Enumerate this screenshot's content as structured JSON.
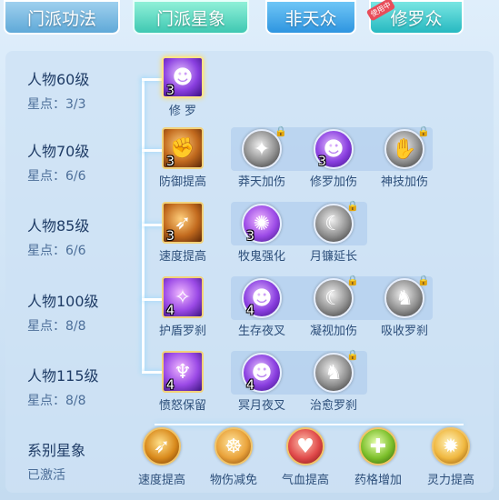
{
  "tabs": [
    {
      "label": "门派功法"
    },
    {
      "label": "门派星象"
    },
    {
      "label": "非天众"
    },
    {
      "label": "修罗众",
      "badge": "使用中"
    }
  ],
  "levels": [
    {
      "title": "人物60级",
      "stars": "星点：3/3"
    },
    {
      "title": "人物70级",
      "stars": "星点：6/6"
    },
    {
      "title": "人物85级",
      "stars": "星点：6/6"
    },
    {
      "title": "人物100级",
      "stars": "星点：8/8"
    },
    {
      "title": "人物115级",
      "stars": "星点：8/8"
    }
  ],
  "rows": [
    {
      "main": {
        "label": "修 罗",
        "num": "3",
        "icon": "demon-face-icon"
      },
      "subs": []
    },
    {
      "main": {
        "label": "防御提高",
        "num": "3",
        "icon": "flexed-arm-icon"
      },
      "subs": [
        {
          "label": "莽天加伤",
          "num": "",
          "icon": "dragon-icon",
          "locked": true
        },
        {
          "label": "修罗加伤",
          "num": "3",
          "icon": "demon-face-icon",
          "locked": false
        },
        {
          "label": "神技加伤",
          "num": "",
          "icon": "claw-icon",
          "locked": true
        }
      ]
    },
    {
      "main": {
        "label": "速度提高",
        "num": "3",
        "icon": "running-figure-icon"
      },
      "subs": [
        {
          "label": "牧鬼强化",
          "num": "3",
          "icon": "chest-icon",
          "locked": false
        },
        {
          "label": "月镰延长",
          "num": "",
          "icon": "sickle-icon",
          "locked": true
        }
      ]
    },
    {
      "main": {
        "label": "护盾罗刹",
        "num": "4",
        "icon": "shield-demon-icon"
      },
      "subs": [
        {
          "label": "生存夜叉",
          "num": "4",
          "icon": "demon-face-icon",
          "locked": false
        },
        {
          "label": "凝视加伤",
          "num": "",
          "icon": "crescent-icon",
          "locked": true
        },
        {
          "label": "吸收罗刹",
          "num": "",
          "icon": "beast-icon",
          "locked": true
        }
      ]
    },
    {
      "main": {
        "label": "愤怒保留",
        "num": "4",
        "icon": "winged-demon-icon"
      },
      "subs": [
        {
          "label": "冥月夜叉",
          "num": "4",
          "icon": "demon-face-icon",
          "locked": false
        },
        {
          "label": "治愈罗刹",
          "num": "",
          "icon": "beast-icon",
          "locked": true
        }
      ]
    }
  ],
  "system": {
    "title": "系别星象",
    "status": "已激活"
  },
  "bottom": [
    {
      "label": "速度提高",
      "icon": "running-figure-icon"
    },
    {
      "label": "物伤减免",
      "icon": "meditation-icon"
    },
    {
      "label": "气血提高",
      "icon": "heart-icon"
    },
    {
      "label": "药格增加",
      "icon": "potion-icon"
    },
    {
      "label": "灵力提高",
      "icon": "sparkle-hand-icon"
    }
  ]
}
